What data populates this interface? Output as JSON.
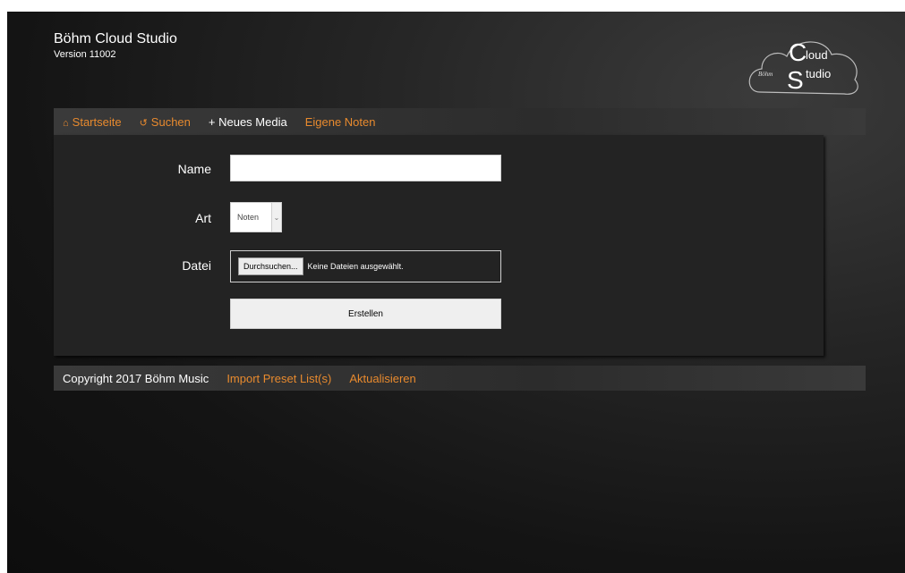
{
  "header": {
    "title": "Böhm Cloud Studio",
    "version": "Version 11002",
    "logo": {
      "big_letter_c": "C",
      "big_letter_s": "S",
      "word_cloud": "loud",
      "word_studio": "tudio",
      "brand": "Böhm"
    }
  },
  "nav": {
    "items": [
      {
        "label": "Startseite",
        "icon": "home-icon",
        "icon_glyph": "⌂",
        "color": "#e88a2e"
      },
      {
        "label": "Suchen",
        "icon": "refresh-icon",
        "icon_glyph": "↺",
        "color": "#e88a2e"
      },
      {
        "label": "+ Neues Media",
        "color": "#ffffff"
      },
      {
        "label": "Eigene Noten",
        "color": "#e88a2e"
      }
    ]
  },
  "form": {
    "name_label": "Name",
    "name_value": "",
    "art_label": "Art",
    "art_selected": "Noten",
    "file_label": "Datei",
    "file_button": "Durchsuchen...",
    "file_status": "Keine Dateien ausgewählt.",
    "submit_label": "Erstellen"
  },
  "footer": {
    "copyright": "Copyright 2017 Böhm Music",
    "import_link": "Import Preset List(s)",
    "refresh_link": "Aktualisieren"
  },
  "colors": {
    "accent": "#e88a2e",
    "text": "#ffffff"
  }
}
